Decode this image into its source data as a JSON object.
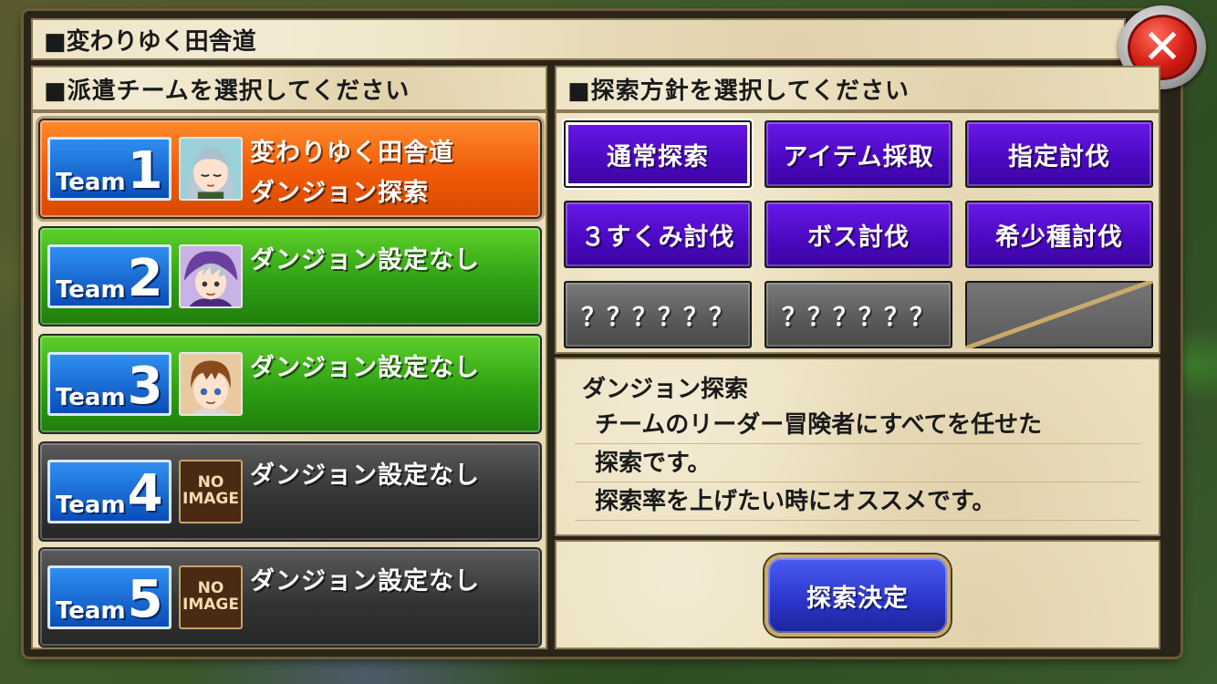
{
  "title": "■変わりゆく田舎道",
  "left_header": "■派遣チームを選択してください",
  "right_header": "■探索方針を選択してください",
  "teams": [
    {
      "word": "Team",
      "num": "1",
      "line1": "変わりゆく田舎道",
      "line2": "ダンジョン探索",
      "state": "selected",
      "avatar": "character-portrait"
    },
    {
      "word": "Team",
      "num": "2",
      "line1": "ダンジョン設定なし",
      "line2": "",
      "state": "green",
      "avatar": "character-portrait"
    },
    {
      "word": "Team",
      "num": "3",
      "line1": "ダンジョン設定なし",
      "line2": "",
      "state": "green",
      "avatar": "character-portrait"
    },
    {
      "word": "Team",
      "num": "4",
      "line1": "ダンジョン設定なし",
      "line2": "",
      "state": "gray",
      "avatar_text": [
        "NO",
        "IMAGE"
      ]
    },
    {
      "word": "Team",
      "num": "5",
      "line1": "ダンジョン設定なし",
      "line2": "",
      "state": "gray",
      "avatar_text": [
        "NO",
        "IMAGE"
      ]
    }
  ],
  "options": [
    {
      "label": "通常探索",
      "state": "selected"
    },
    {
      "label": "アイテム採取",
      "state": "available"
    },
    {
      "label": "指定討伐",
      "state": "available"
    },
    {
      "label": "３すくみ討伐",
      "state": "available"
    },
    {
      "label": "ボス討伐",
      "state": "available"
    },
    {
      "label": "希少種討伐",
      "state": "available"
    },
    {
      "label": "？？？？？？",
      "state": "unknown"
    },
    {
      "label": "？？？？？？",
      "state": "unknown"
    },
    {
      "label": "",
      "state": "locked"
    }
  ],
  "description": {
    "title": "ダンジョン探索",
    "lines": [
      "チームのリーダー冒険者にすべてを任せた",
      "探索です。",
      "探索率を上げたい時にオススメです。"
    ]
  },
  "decide_button": "探索決定",
  "colors": {
    "accent": "#4a08c0",
    "selected_team": "#f05a08",
    "set_team": "#2fa014",
    "empty_team": "#343434"
  }
}
